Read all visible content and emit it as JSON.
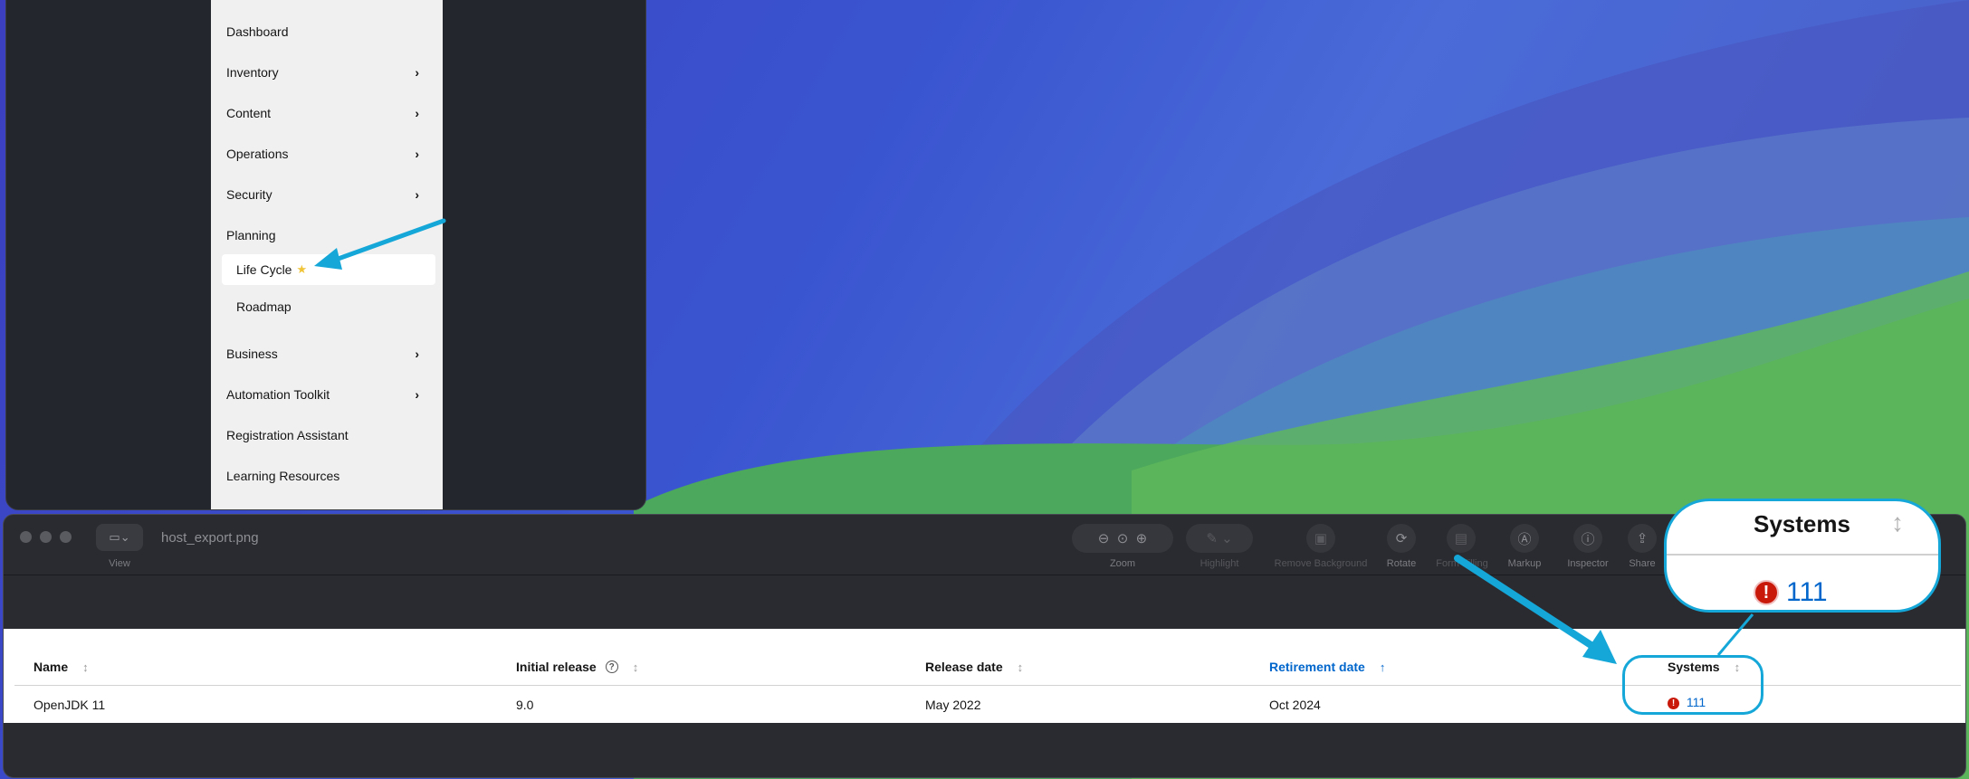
{
  "nav": {
    "items": [
      {
        "label": "Dashboard",
        "has_chevron": false
      },
      {
        "label": "Inventory",
        "has_chevron": true
      },
      {
        "label": "Content",
        "has_chevron": true
      },
      {
        "label": "Operations",
        "has_chevron": true
      },
      {
        "label": "Security",
        "has_chevron": true
      },
      {
        "label": "Planning",
        "has_chevron": false
      }
    ],
    "planning_children": [
      {
        "label": "Life Cycle",
        "active": true,
        "starred": true
      },
      {
        "label": "Roadmap",
        "active": false,
        "starred": false
      }
    ],
    "items_after": [
      {
        "label": "Business",
        "has_chevron": true
      },
      {
        "label": "Automation Toolkit",
        "has_chevron": true
      },
      {
        "label": "Registration Assistant",
        "has_chevron": false
      },
      {
        "label": "Learning Resources",
        "has_chevron": false
      }
    ],
    "star_glyph": "★",
    "chevron_glyph": "›"
  },
  "preview": {
    "filename": "host_export.png",
    "toolbar": {
      "view_label": "View",
      "zoom_label": "Zoom",
      "highlight_label": "Highlight",
      "remove_bg_label": "Remove Background",
      "rotate_label": "Rotate",
      "form_filling_label": "Form Filling",
      "markup_label": "Markup",
      "inspector_label": "Inspector",
      "share_label": "Share"
    }
  },
  "table": {
    "columns": [
      {
        "label": "Name",
        "sorted": false
      },
      {
        "label": "Initial release",
        "sorted": false,
        "help": true
      },
      {
        "label": "Release date",
        "sorted": false
      },
      {
        "label": "Retirement date",
        "sorted": true
      },
      {
        "label": "Systems",
        "sorted": false
      }
    ],
    "rows": [
      {
        "name": "OpenJDK 11",
        "initial_release": "9.0",
        "release_date": "May 2022",
        "retirement_date": "Oct 2024",
        "systems": "111"
      }
    ]
  },
  "callout": {
    "title": "Systems",
    "value": "111"
  },
  "colors": {
    "accent_blue": "#0066cc",
    "callout_cyan": "#14a7d8",
    "danger_red": "#c9190b"
  }
}
